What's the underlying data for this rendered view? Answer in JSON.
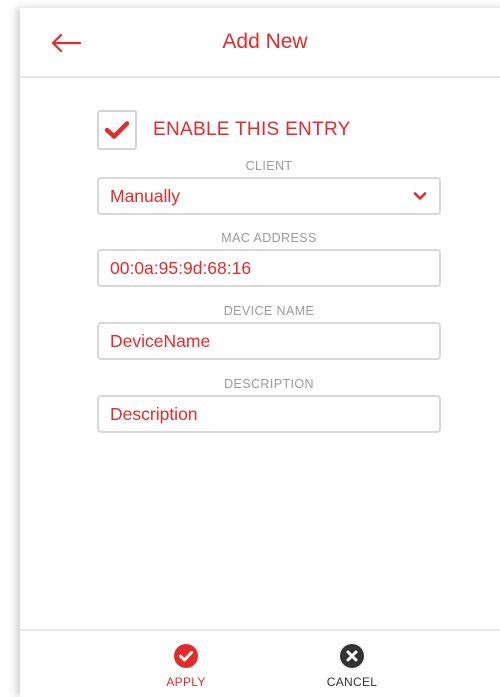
{
  "header": {
    "title": "Add New",
    "back_icon": "arrow-left-icon"
  },
  "enable": {
    "label": "ENABLE THIS ENTRY",
    "checked": true
  },
  "fields": {
    "client": {
      "label": "CLIENT",
      "value": "Manually"
    },
    "mac": {
      "label": "MAC ADDRESS",
      "value": "00:0a:95:9d:68:16"
    },
    "device_name": {
      "label": "DEVICE NAME",
      "value": "DeviceName"
    },
    "description": {
      "label": "DESCRIPTION",
      "value": "Description"
    }
  },
  "footer": {
    "apply_label": "APPLY",
    "cancel_label": "CANCEL"
  },
  "colors": {
    "accent": "#e32b2b",
    "cancel_icon": "#333333",
    "border": "#d8d8d8"
  }
}
